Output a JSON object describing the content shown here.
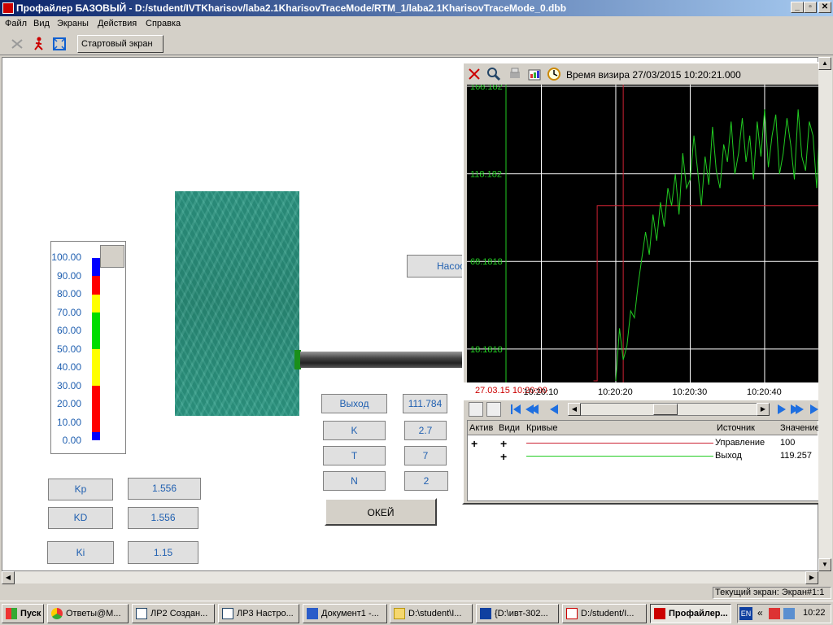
{
  "window": {
    "title": "Профайлер БАЗОВЫЙ - D:/student/IVTKharisov/laba2.1KharisovTraceMode/RTM_1/laba2.1KharisovTraceMode_0.dbb",
    "minimize": "_",
    "maximize": "▫",
    "close": "✕"
  },
  "menu": [
    "Файл",
    "Вид",
    "Экраны",
    "Действия",
    "Справка"
  ],
  "toolbar": {
    "start_screen": "Стартовый экран"
  },
  "tank_scale": {
    "labels": [
      "100.00",
      "90.00",
      "80.00",
      "70.00",
      "60.00",
      "50.00",
      "40.00",
      "30.00",
      "20.00",
      "10.00",
      "0.00"
    ]
  },
  "pump_label": "Насос",
  "params": {
    "output_label": "Выход",
    "output_value": "111.784",
    "k_label": "K",
    "k_value": "2.7",
    "t_label": "T",
    "t_value": "7",
    "n_label": "N",
    "n_value": "2",
    "ok_label": "ОКЕЙ",
    "kp_label": "Kp",
    "kp_value": "1.556",
    "kd_label": "KD",
    "kd_value": "1.556",
    "ki_label": "Ki",
    "ki_value": "1.15"
  },
  "trend": {
    "sight_time": "Время визира 27/03/2015 10:20:21.000",
    "x_start_label": "27.03.15 10:20:00",
    "legend_headers": {
      "active": "Актив",
      "visible": "Види",
      "curves": "Кривые",
      "source": "Источник",
      "value": "Значение"
    },
    "legend_rows": [
      {
        "active": "+",
        "visible": "+",
        "source": "Управление",
        "value": "100",
        "color": "#cc2233"
      },
      {
        "active": "",
        "visible": "+",
        "source": "Выход",
        "value": "119.257",
        "color": "#22cc22"
      }
    ]
  },
  "chart_data": {
    "type": "line",
    "y_ticks": [
      "168.182",
      "118.182",
      "68.1818",
      "18.1818"
    ],
    "x_ticks": [
      "10:20:10",
      "10:20:20",
      "10:20:30",
      "10:20:40"
    ],
    "ylim": [
      0,
      168.182
    ],
    "xlim": [
      0,
      47
    ],
    "series": [
      {
        "name": "Управление",
        "color": "#cc2233",
        "x": [
          8.5,
          9.0,
          9.0,
          47
        ],
        "y": [
          0,
          0,
          100,
          100
        ]
      },
      {
        "name": "Выход",
        "color": "#22cc22",
        "x": [
          11.5,
          12,
          12.5,
          13,
          13.5,
          14,
          14.5,
          15,
          15.5,
          16,
          16.5,
          17,
          17.5,
          18,
          18.5,
          19,
          19.5,
          20,
          20.5,
          21,
          21.5,
          22,
          22.5,
          23,
          23.5,
          24,
          24.5,
          25,
          25.5,
          26,
          26.5,
          27,
          27.5,
          28,
          28.5,
          29,
          29.5,
          30,
          30.5,
          31,
          31.5,
          32,
          32.5,
          33,
          33.5,
          34,
          34.5,
          35,
          35.5,
          36,
          36.5,
          37,
          37.5,
          38,
          38.5,
          39,
          39.5,
          40,
          40.5,
          41,
          41.5,
          42,
          42.5,
          43,
          43.5,
          44,
          44.5,
          45,
          45.5,
          46,
          46.5,
          47
        ],
        "y": [
          0,
          30,
          12,
          20,
          40,
          36,
          55,
          70,
          85,
          72,
          95,
          80,
          102,
          88,
          110,
          100,
          118,
          95,
          130,
          110,
          115,
          140,
          120,
          100,
          128,
          112,
          145,
          120,
          110,
          135,
          125,
          148,
          118,
          130,
          150,
          125,
          140,
          115,
          148,
          128,
          155,
          122,
          140,
          152,
          118,
          130,
          150,
          135,
          115,
          155,
          128,
          120,
          148,
          140,
          110,
          155,
          130,
          122,
          152,
          135,
          118,
          140,
          126,
          110,
          128,
          150,
          132,
          145,
          138,
          155,
          120,
          130
        ]
      }
    ]
  },
  "status": {
    "current_screen": "Текущий экран: Экран#1:1"
  },
  "taskbar": {
    "start": "Пуск",
    "tasks": [
      "Ответы@M...",
      "ЛР2 Создан...",
      "ЛР3 Настро...",
      "Документ1 -...",
      "D:\\student\\I...",
      "{D:\\ивт-302...",
      "D:/student/I...",
      "Профайлер..."
    ],
    "lang": "EN",
    "clock": "10:22"
  }
}
